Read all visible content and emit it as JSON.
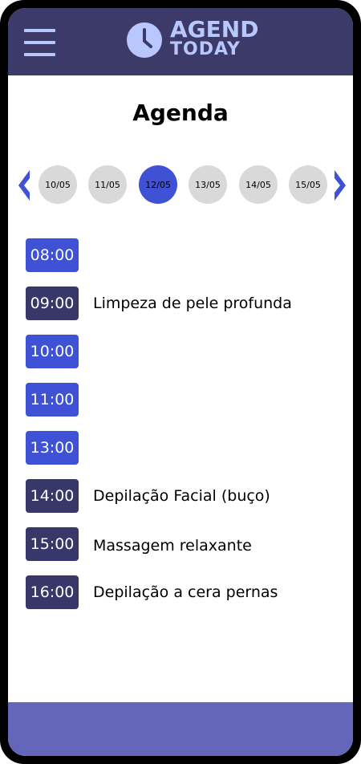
{
  "header": {
    "logo": {
      "line1": "AGEND",
      "line2": "TODAY"
    }
  },
  "page": {
    "title": "Agenda"
  },
  "dates": [
    {
      "label": "10/05",
      "selected": false
    },
    {
      "label": "11/05",
      "selected": false
    },
    {
      "label": "12/05",
      "selected": true
    },
    {
      "label": "13/05",
      "selected": false
    },
    {
      "label": "14/05",
      "selected": false
    },
    {
      "label": "15/05",
      "selected": false
    }
  ],
  "schedule": [
    {
      "time": "08:00",
      "status": "free",
      "service": ""
    },
    {
      "time": "09:00",
      "status": "booked",
      "service": "Limpeza de pele profunda"
    },
    {
      "time": "10:00",
      "status": "free",
      "service": ""
    },
    {
      "time": "11:00",
      "status": "free",
      "service": ""
    },
    {
      "time": "13:00",
      "status": "free",
      "service": ""
    },
    {
      "time": "14:00",
      "status": "booked",
      "service": "Depilação Facial (buço)"
    },
    {
      "time": "15:00",
      "status": "booked",
      "service": "Massagem relaxante"
    },
    {
      "time": "16:00",
      "status": "booked",
      "service": "Depilação a cera pernas"
    }
  ],
  "icons": {
    "menu": "hamburger-menu-icon",
    "logo": "clock-icon",
    "prev": "chevron-left-icon",
    "next": "chevron-right-icon"
  },
  "colors": {
    "header": "#3b3a69",
    "accent_light": "#b8c8ff",
    "slot_free": "#3f51d5",
    "slot_booked": "#38376a",
    "date_selected": "#3f51d5",
    "date_default": "#d9d9d9",
    "footer": "#6466b9"
  }
}
